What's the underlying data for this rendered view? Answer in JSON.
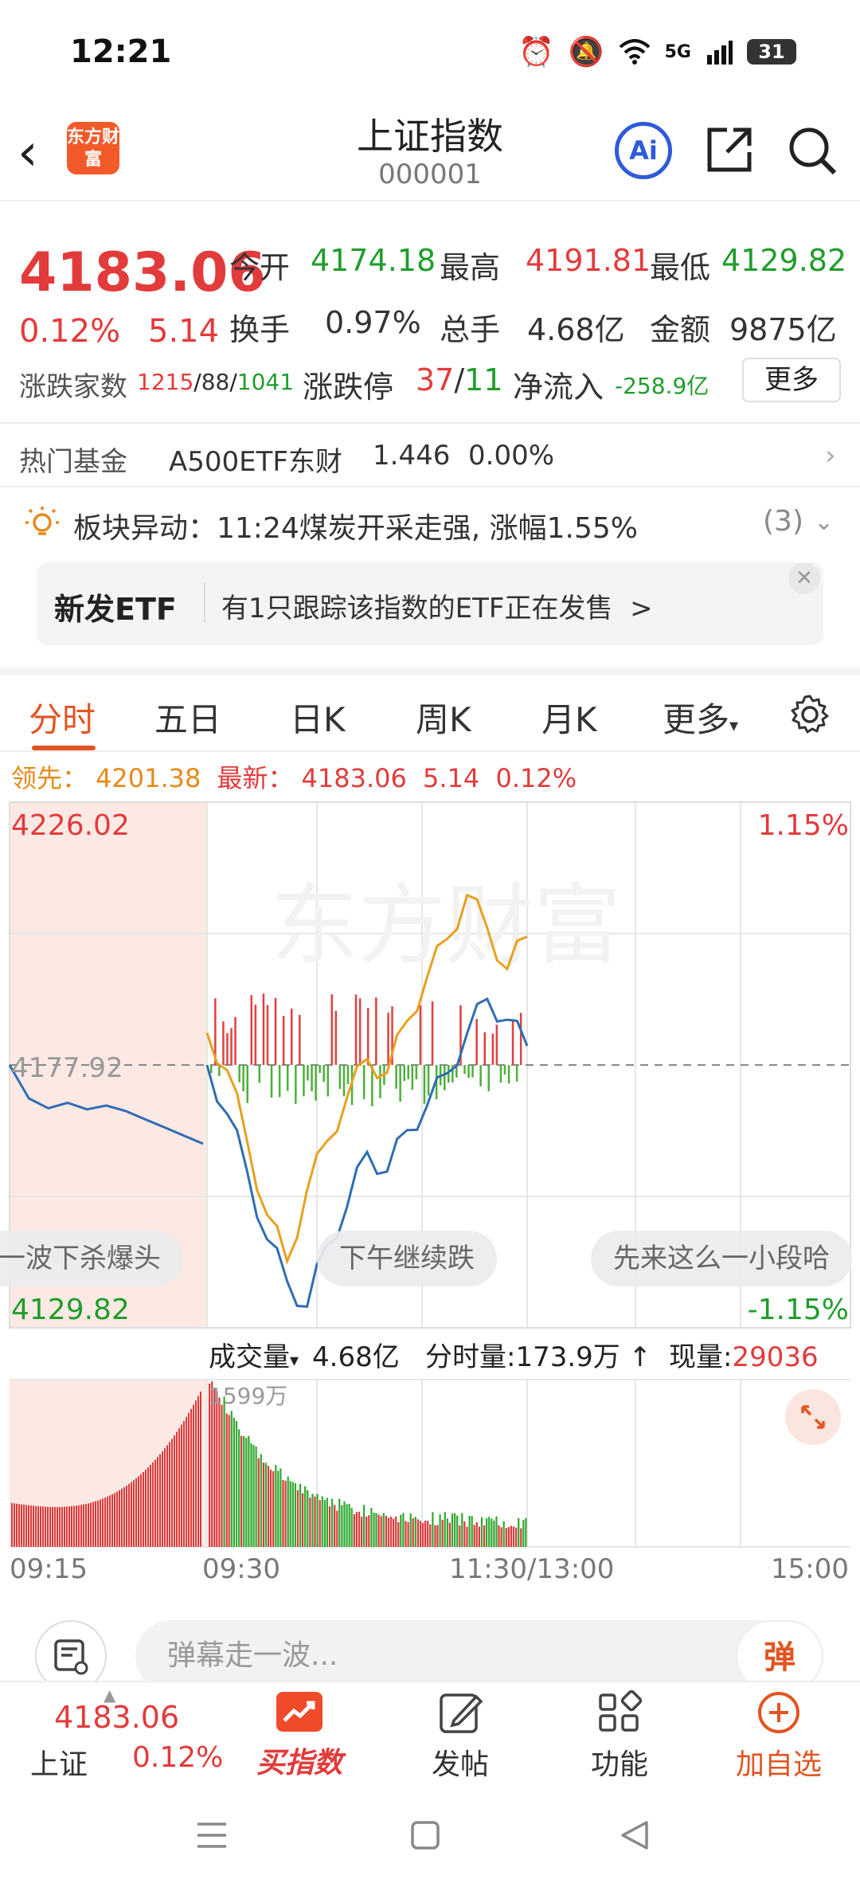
{
  "status_bar": {
    "time": "12:21",
    "battery": "31",
    "network": "5G"
  },
  "header": {
    "logo_text": "东方财富",
    "title": "上证指数",
    "code": "000001",
    "ai_label": "Ai"
  },
  "quote": {
    "price": "4183.06",
    "change_pct": "0.12%",
    "change": "5.14",
    "open_label": "今开",
    "open": "4174.18",
    "high_label": "最高",
    "high": "4191.81",
    "low_label": "最低",
    "low": "4129.82",
    "turnover_label": "换手",
    "turnover": "0.97%",
    "volume_label": "总手",
    "volume": "4.68亿",
    "amount_label": "金额",
    "amount": "9875亿",
    "breadth_label": "涨跌家数",
    "up": "1215",
    "flat": "88",
    "down": "1041",
    "limit_label": "涨跌停",
    "limit_up": "37",
    "limit_down": "11",
    "netflow_label": "净流入",
    "netflow": "-258.9亿",
    "more_label": "更多"
  },
  "fund_row": {
    "label": "热门基金",
    "name": "A500ETF东财",
    "price": "1.446",
    "pct": "0.00%"
  },
  "alert": {
    "text": "板块异动：11:24煤炭开采走强, 涨幅1.55%",
    "count": "(3)"
  },
  "banner": {
    "tag": "新发ETF",
    "text": "有1只跟踪该指数的ETF正在发售",
    "arrow": ">"
  },
  "tabs": [
    {
      "label": "分时"
    },
    {
      "label": "五日"
    },
    {
      "label": "日K"
    },
    {
      "label": "周K"
    },
    {
      "label": "月K"
    },
    {
      "label": "更多"
    }
  ],
  "legend": {
    "lead_label": "领先：",
    "lead": "4201.38",
    "latest_label": "最新：",
    "latest": "4183.06",
    "change": "5.14",
    "pct": "0.12%"
  },
  "chart_data": {
    "type": "line",
    "title": "",
    "watermark": "东方财富",
    "y_range": [
      4129.82,
      4226.02
    ],
    "prev_close": 4177.92,
    "y_labels": {
      "top": "4226.02",
      "top_pct": "1.15%",
      "mid": "4177.92",
      "bottom": "4129.82",
      "bottom_pct": "-1.15%"
    },
    "x_labels": [
      "09:15",
      "09:30",
      "11:30/13:00",
      "15:00"
    ],
    "series": [
      {
        "color": "#2f6db3",
        "values": [
          4177.9,
          4169.0,
          4158.5,
          4146.0,
          4138.4,
          4133.7,
          4145.0,
          4152.0,
          4162.0,
          4158.4,
          4166.0,
          4170.5,
          4176.4,
          4183.7,
          4190.0,
          4186.2,
          4181.4
        ]
      },
      {
        "color": "#e8a020",
        "values": [
          4183.8,
          4177.0,
          4164.0,
          4150.5,
          4142.0,
          4155.0,
          4164.0,
          4172.0,
          4179.0,
          4176.5,
          4186.0,
          4194.0,
          4201.0,
          4209.0,
          4203.0,
          4195.5,
          4201.4
        ]
      }
    ],
    "auction_series": [
      4177.9,
      4171.8,
      4170.0,
      4171.0,
      4169.8,
      4170.5,
      4169.5,
      4168.0,
      4166.5,
      4165.0,
      4163.5
    ]
  },
  "bubbles": [
    "一波下杀爆头",
    "下午继续跌",
    "先来这么一小段哈"
  ],
  "volume_bar": {
    "label": "成交量",
    "total": "4.68亿",
    "minute_label": "分时量:",
    "minute": "173.9万",
    "arrow": "↑",
    "current_label": "现量:",
    "current": "29036",
    "max_label": "1599万"
  },
  "comment": {
    "placeholder": "弹幕走一波...",
    "dan": "弹"
  },
  "bottom_nav": {
    "price": "4183.06",
    "name": "上证",
    "pct": "0.12%",
    "items": [
      {
        "label": "买指数"
      },
      {
        "label": "发帖"
      },
      {
        "label": "功能"
      },
      {
        "label": "加自选"
      }
    ]
  }
}
